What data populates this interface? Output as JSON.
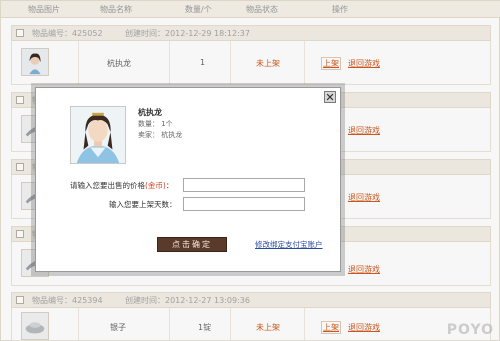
{
  "columns": {
    "item_image": "物品图片",
    "item_name": "物品名称",
    "quantity": "数量/个",
    "item_status": "物品状态",
    "operation": "操作"
  },
  "group1": {
    "item_no": "物品编号：425052",
    "created": "创建时间：2012-12-29 18:12:37",
    "name": "杭执龙",
    "qty": "1",
    "status": "未上架",
    "shelve": "上架",
    "retrieve": "退回游戏"
  },
  "group2": {
    "head_fragment": "物",
    "retrieve": "退回游戏"
  },
  "group3": {
    "head_fragment": "物",
    "retrieve": "退回游戏"
  },
  "group4": {
    "head_fragment": "物",
    "retrieve": "退回游戏"
  },
  "group5": {
    "item_no": "物品编号：425394",
    "created": "创建时间：2012-12-27 13:09:36",
    "name": "银子",
    "qty": "1锭",
    "status": "未上架",
    "shelve": "上架",
    "retrieve": "退回游戏"
  },
  "dialog": {
    "item_name": "杭执龙",
    "quantity_line": "数量： 1个",
    "seller_line": "卖家： 杭执龙",
    "price_label": "请输入您要出售的价格",
    "price_req": "(金币)",
    "price_colon": "：",
    "price_value": "",
    "days_label": "输入您要上架天数：",
    "days_value": "",
    "confirm": "点击确定",
    "alipay_link": "修改绑定支付宝账户"
  },
  "watermark": "POYO",
  "colors": {
    "status": "#d05a1e",
    "link_blue": "#2a4aa0",
    "button_dark": "#5a3a2a"
  }
}
